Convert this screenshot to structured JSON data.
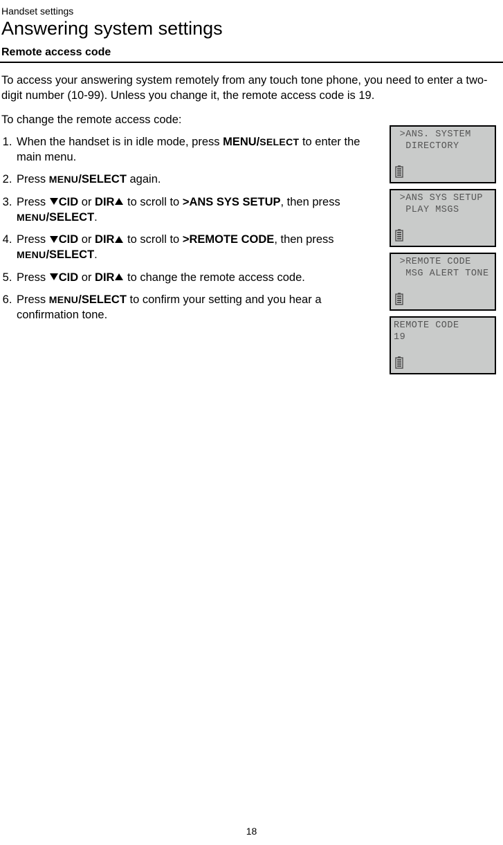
{
  "breadcrumb": "Handset settings",
  "pageTitle": "Answering system settings",
  "subheading": "Remote access code",
  "intro": "To access your answering system remotely from any touch tone phone, you need to enter a two-digit number (10-99). Unless you change it, the remote access code is 19.",
  "lead": "To change the remote access code:",
  "steps": {
    "s1a": "When the handset is in idle mode, press ",
    "s1b": "MENU/",
    "s1c": "SELECT",
    "s1d": " to enter the main menu.",
    "s2a": "Press ",
    "s2b": "MENU",
    "s2c": "/SELECT",
    "s2d": " again.",
    "s3a": "Press ",
    "s3b": "CID",
    "s3c": " or ",
    "s3d": "DIR",
    "s3e": " to scroll to ",
    "s3f": ">ANS SYS SETUP",
    "s3g": ", then press ",
    "s3h": "MENU",
    "s3i": "/SELECT",
    "s3j": ".",
    "s4a": "Press ",
    "s4b": "CID",
    "s4c": " or ",
    "s4d": "DIR",
    "s4e": " to scroll to ",
    "s4f": ">REMOTE CODE",
    "s4g": ", then press ",
    "s4h": "MENU",
    "s4i": "/SELECT",
    "s4j": ".",
    "s5a": "Press ",
    "s5b": "CID",
    "s5c": " or ",
    "s5d": "DIR",
    "s5e": " to change the remote access code.",
    "s6a": "Press ",
    "s6b": "MENU",
    "s6c": "/SELECT",
    "s6d": " to confirm your setting and you hear a confirmation tone."
  },
  "screens": [
    {
      "line1": " >ANS. SYSTEM",
      "line2": "  DIRECTORY"
    },
    {
      "line1": " >ANS SYS SETUP",
      "line2": "  PLAY MSGS"
    },
    {
      "line1": " >REMOTE CODE",
      "line2": "  MSG ALERT TONE"
    },
    {
      "line1": "REMOTE CODE",
      "line2": "19"
    }
  ],
  "pageNumber": "18"
}
